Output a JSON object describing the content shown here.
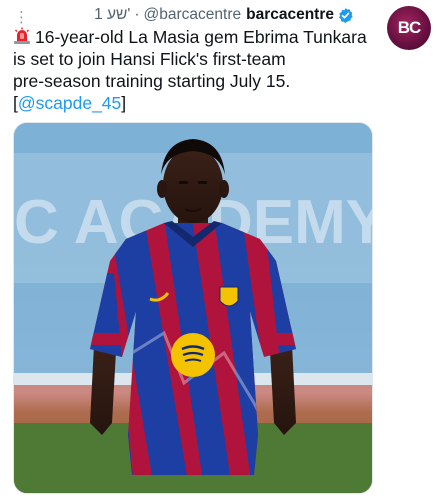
{
  "header": {
    "time": "1 שע'",
    "separator": "·",
    "handle": "@barcacentre",
    "display_name": "barcacentre",
    "avatar_text": "BC",
    "icons": {
      "more": "more-vertical-icon",
      "verified": "verified-badge-icon",
      "siren": "police-light-emoji-icon"
    }
  },
  "tweet": {
    "line1": "16-year-old La Masia gem Ebrima Tunkara",
    "line2": "is set to join Hansi Flick's first-team",
    "line3": "pre-season training starting July 15.",
    "mention_open": "[",
    "mention": "@scapde_45",
    "mention_close": "]"
  },
  "media": {
    "alt": "Player in Barcelona kit posing in front of a stadium wall"
  },
  "colors": {
    "accent": "#1d9bf0",
    "kit_blue": "#1d3ea3",
    "kit_red": "#b0143c",
    "avatar": "#7a1549",
    "sponsor_yellow": "#f3c300"
  }
}
